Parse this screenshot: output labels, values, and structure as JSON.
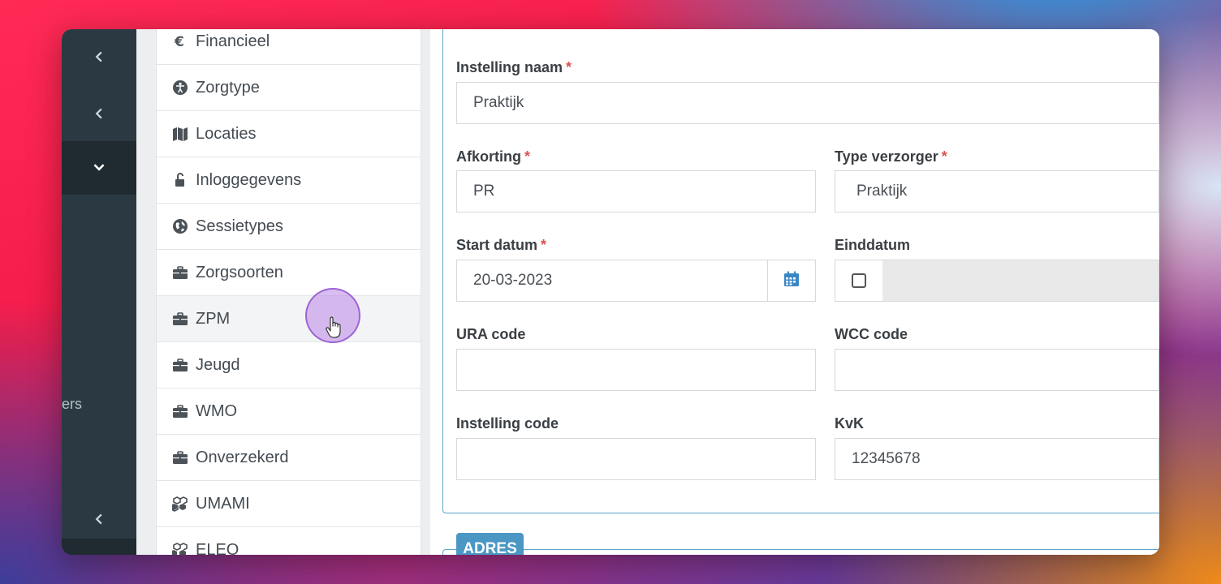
{
  "rail": {
    "partial_label": "ers"
  },
  "menu": {
    "items": [
      {
        "label": "Financieel",
        "icon": "euro-icon"
      },
      {
        "label": "Zorgtype",
        "icon": "accessibility-icon"
      },
      {
        "label": "Locaties",
        "icon": "map-icon"
      },
      {
        "label": "Inloggegevens",
        "icon": "unlock-icon"
      },
      {
        "label": "Sessietypes",
        "icon": "globe-icon"
      },
      {
        "label": "Zorgsoorten",
        "icon": "briefcase-icon"
      },
      {
        "label": "ZPM",
        "icon": "briefcase-icon"
      },
      {
        "label": "Jeugd",
        "icon": "briefcase-icon"
      },
      {
        "label": "WMO",
        "icon": "briefcase-icon"
      },
      {
        "label": "Onverzekerd",
        "icon": "briefcase-icon"
      },
      {
        "label": "UMAMI",
        "icon": "cubes-icon"
      },
      {
        "label": "ELEO",
        "icon": "cubes-icon"
      }
    ]
  },
  "form": {
    "instelling_naam": {
      "label": "Instelling naam",
      "required": "*",
      "value": "Praktijk"
    },
    "afkorting": {
      "label": "Afkorting",
      "required": "*",
      "value": "PR"
    },
    "type_verzorger": {
      "label": "Type verzorger",
      "required": "*",
      "value": "Praktijk"
    },
    "start_datum": {
      "label": "Start datum",
      "required": "*",
      "value": "20-03-2023"
    },
    "einddatum": {
      "label": "Einddatum"
    },
    "ura_code": {
      "label": "URA code",
      "value": ""
    },
    "wcc_code": {
      "label": "WCC code",
      "value": ""
    },
    "instelling_code": {
      "label": "Instelling code",
      "value": ""
    },
    "kvk": {
      "label": "KvK",
      "value": "12345678"
    }
  },
  "sections": {
    "adres": "ADRES"
  },
  "colors": {
    "accent": "#4a97c4",
    "rail": "#2b3a42",
    "required": "#d9534f"
  }
}
